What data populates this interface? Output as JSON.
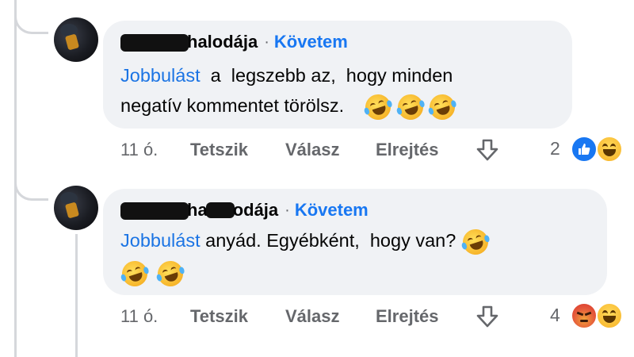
{
  "comments": [
    {
      "author_suffix": "halodája",
      "separator": "·",
      "follow_label": "Követem",
      "mention": "Jobbulást",
      "text_line1": "  a  legszebb az,  hogy minden",
      "text_line2": "negatív kommentet törölsz.",
      "emoji_count": 3,
      "time": "11 ó.",
      "like_label": "Tetszik",
      "reply_label": "Válasz",
      "hide_label": "Elrejtés",
      "reaction_count": "2",
      "reactions": [
        "like-icon",
        "haha-icon"
      ]
    },
    {
      "author_suffix": "odája",
      "author_prefix_visible": "ha",
      "separator": "·",
      "follow_label": "Követem",
      "mention": "Jobbulást",
      "text_line1": " anyád. Egyébként,  hogy van?",
      "emoji_count": 3,
      "time": "11 ó.",
      "like_label": "Tetszik",
      "reply_label": "Válasz",
      "hide_label": "Elrejtés",
      "reaction_count": "4",
      "reactions": [
        "angry-icon",
        "haha-icon"
      ]
    }
  ],
  "colors": {
    "bubble": "#f0f2f5",
    "link": "#1877f2",
    "meta": "#65676b",
    "thread_line": "#d5d7db"
  }
}
